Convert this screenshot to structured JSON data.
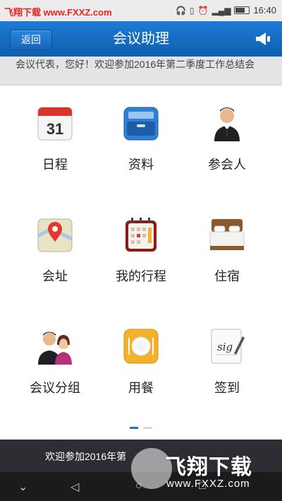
{
  "status_bar": {
    "watermark": "飞翔下载 www.FXXZ.com",
    "time": "16:40"
  },
  "app_bar": {
    "back_label": "返回",
    "title": "会议助理"
  },
  "ticker": {
    "text": "会议代表，您好！欢迎参加2016年第二季度工作总结会"
  },
  "grid": {
    "items": [
      {
        "label": "日程",
        "icon": "calendar-icon",
        "calendar_day": "31"
      },
      {
        "label": "资料",
        "icon": "file-drawer-icon"
      },
      {
        "label": "参会人",
        "icon": "person-icon"
      },
      {
        "label": "会址",
        "icon": "map-pin-icon"
      },
      {
        "label": "我的行程",
        "icon": "planner-icon"
      },
      {
        "label": "住宿",
        "icon": "bed-icon"
      },
      {
        "label": "会议分组",
        "icon": "group-icon"
      },
      {
        "label": "用餐",
        "icon": "plate-icon"
      },
      {
        "label": "签到",
        "icon": "signature-icon",
        "sig_text": "sig"
      }
    ]
  },
  "pager": {
    "pages": 2,
    "active": 0
  },
  "bottom_banner": {
    "text": "欢迎参加2016年第"
  },
  "watermark": {
    "title": "飞翔下载",
    "url": "www.FXXZ.com"
  },
  "colors": {
    "app_bar": "#1a72cc",
    "bottom_bar": "#2d2d34",
    "pager_active": "#1a72cc",
    "pager_inactive": "#cfd8e3"
  }
}
